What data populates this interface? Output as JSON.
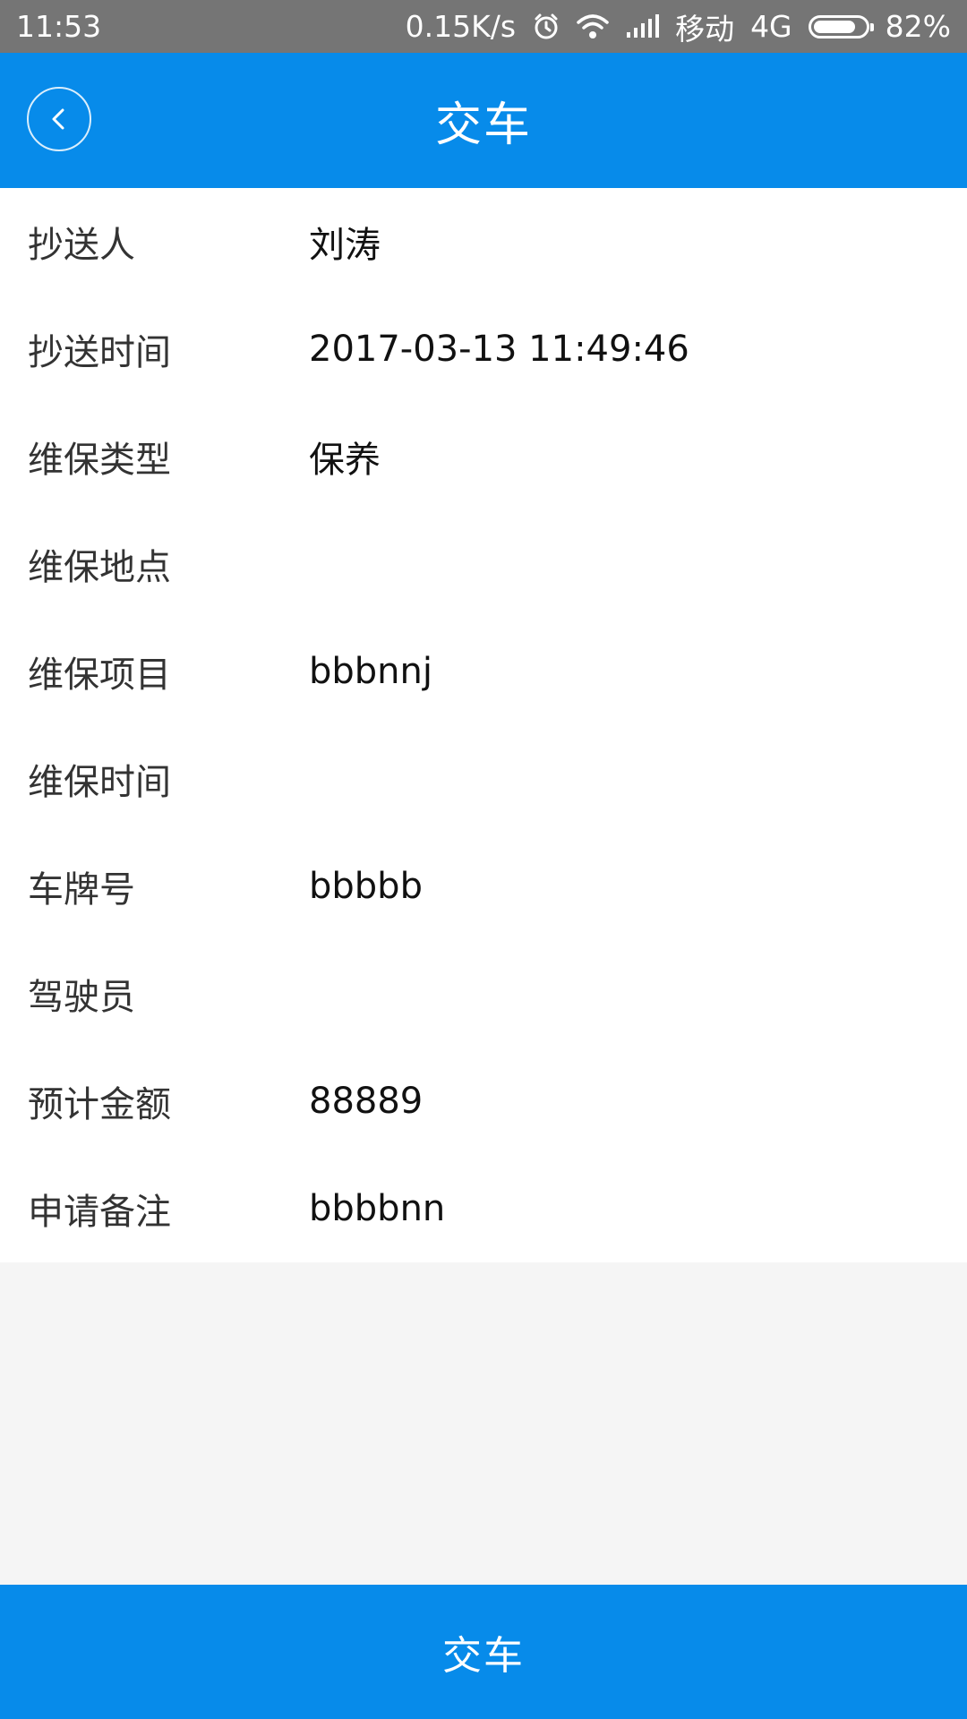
{
  "status_bar": {
    "time": "11:53",
    "net_speed": "0.15K/s",
    "carrier": "移动",
    "network": "4G",
    "battery": "82%",
    "battery_level": 0.82,
    "icons": [
      "alarm-icon",
      "wifi-icon",
      "signal-icon",
      "battery-icon"
    ]
  },
  "header": {
    "title": "交车",
    "back_icon": "chevron-left-icon"
  },
  "details": {
    "rows": [
      {
        "label": "抄送人",
        "value": "刘涛"
      },
      {
        "label": "抄送时间",
        "value": "2017-03-13 11:49:46"
      },
      {
        "label": "维保类型",
        "value": "保养"
      },
      {
        "label": "维保地点",
        "value": ""
      },
      {
        "label": "维保项目",
        "value": "bbbnnj"
      },
      {
        "label": "维保时间",
        "value": ""
      },
      {
        "label": "车牌号",
        "value": "bbbbb"
      },
      {
        "label": "驾驶员",
        "value": ""
      },
      {
        "label": "预计金额",
        "value": "88889"
      },
      {
        "label": "申请备注",
        "value": "bbbbnn"
      }
    ]
  },
  "footer": {
    "submit_label": "交车"
  },
  "colors": {
    "primary": "#078bea",
    "status_bar": "#757575",
    "page_background": "#f5f5f5",
    "card_background": "#ffffff"
  }
}
